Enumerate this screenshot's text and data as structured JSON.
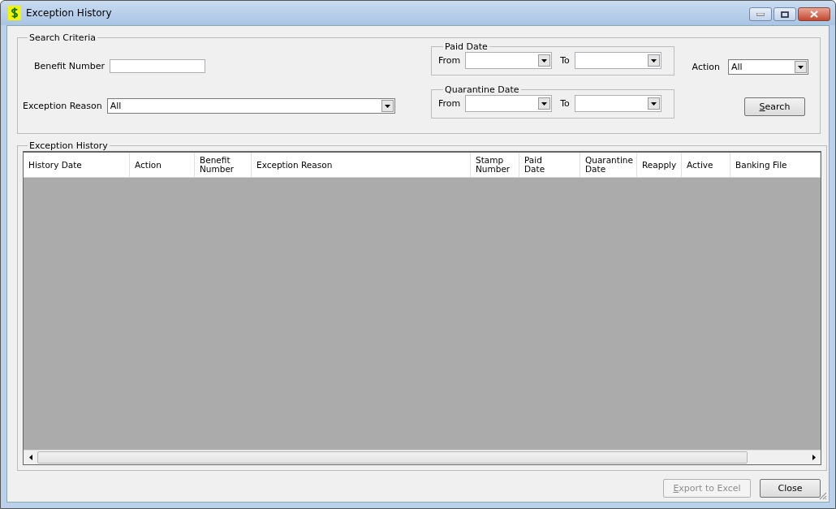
{
  "window": {
    "title": "Exception History"
  },
  "search_criteria": {
    "title": "Search Criteria",
    "benefit_number": {
      "label": "Benefit Number"
    },
    "exception_reason": {
      "label": "Exception Reason",
      "value": "All"
    },
    "paid_date": {
      "title": "Paid Date",
      "from_label": "From",
      "to_label": "To"
    },
    "quarantine_date": {
      "title": "Quarantine Date",
      "from_label": "From",
      "to_label": "To"
    },
    "action": {
      "label": "Action",
      "value": "All"
    },
    "search_button": {
      "label": "Search",
      "disabled": false
    }
  },
  "history": {
    "title": "Exception History",
    "columns": [
      {
        "label": "History Date"
      },
      {
        "label": "Action"
      },
      {
        "label": "Benefit\nNumber"
      },
      {
        "label": "Exception Reason"
      },
      {
        "label": "Stamp\nNumber"
      },
      {
        "label": "Paid\nDate"
      },
      {
        "label": "Quarantine\nDate"
      },
      {
        "label": "Reapply"
      },
      {
        "label": "Active"
      },
      {
        "label": "Banking File"
      }
    ]
  },
  "buttons": [
    {
      "label": "Export to Excel",
      "disabled": true
    },
    {
      "label": "Close",
      "disabled": false
    }
  ]
}
